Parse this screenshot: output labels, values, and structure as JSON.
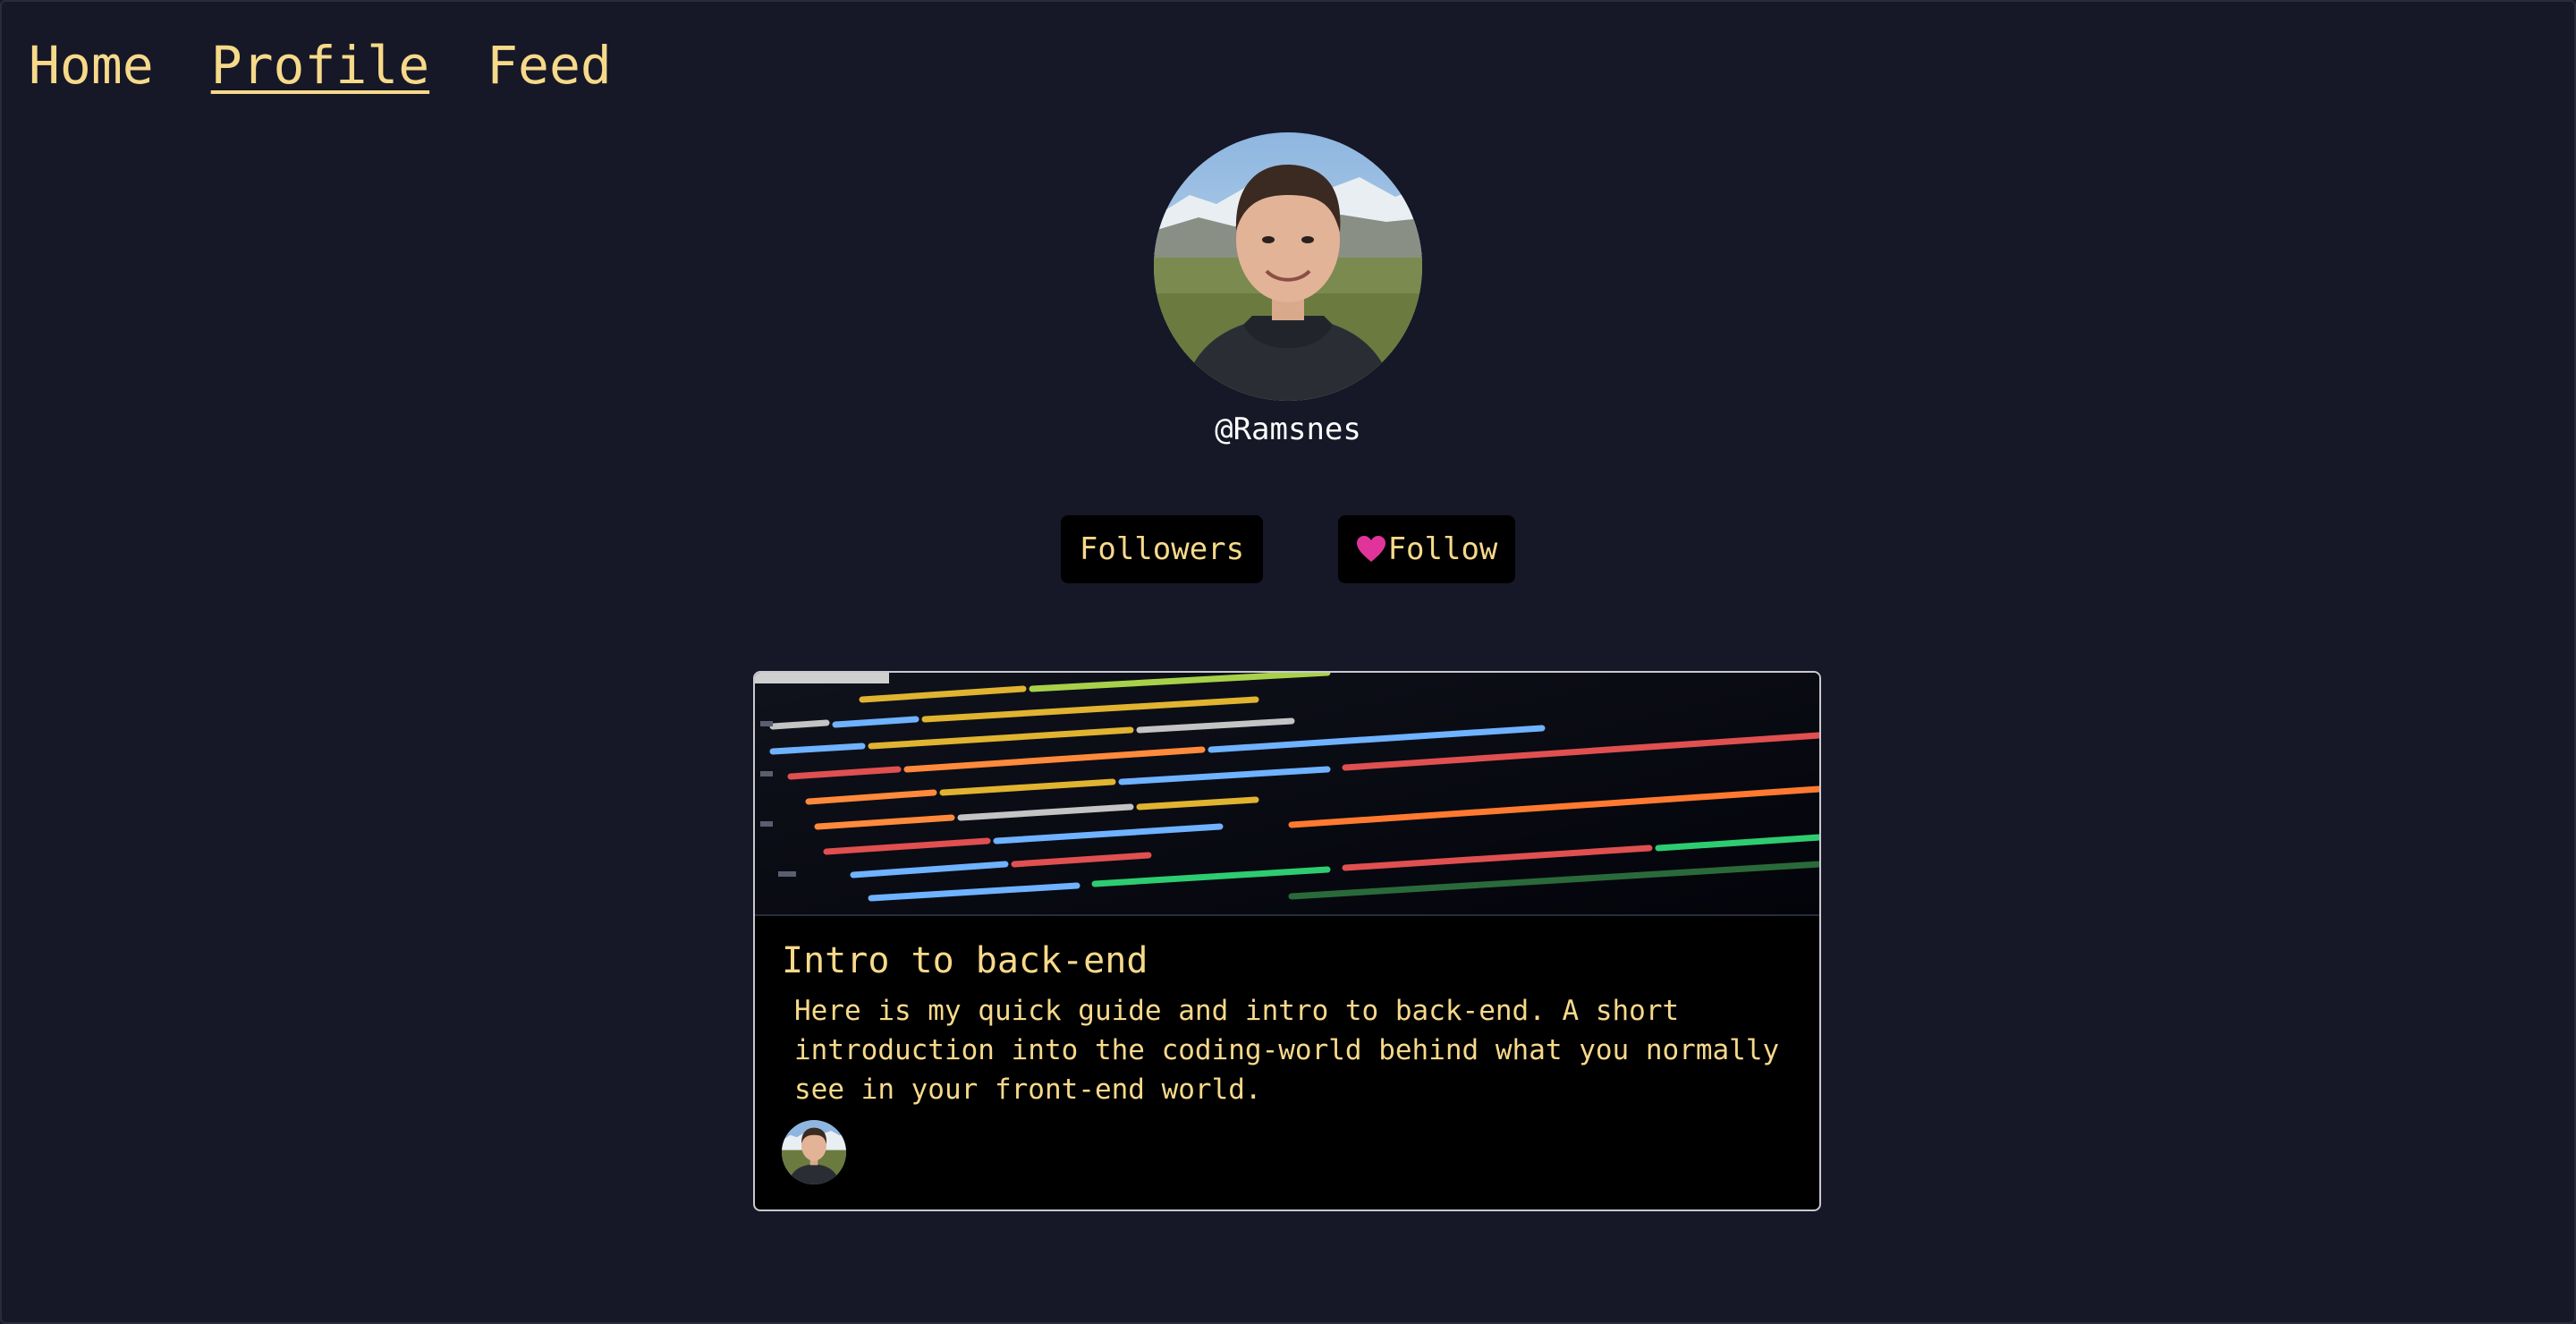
{
  "nav": {
    "items": [
      {
        "label": "Home",
        "active": false
      },
      {
        "label": "Profile",
        "active": true
      },
      {
        "label": "Feed",
        "active": false
      }
    ]
  },
  "profile": {
    "username": "@Ramsnes",
    "followers_label": "Followers",
    "follow_label": "Follow",
    "follow_icon": "heart-icon"
  },
  "post": {
    "title": "Intro to back-end",
    "body": "Here is my quick guide and intro to back-end. A short introduction into the coding-world behind what you normally see in your front-end world."
  },
  "colors": {
    "background": "#161827",
    "accent_text": "#f7d98a",
    "heart": "#e0349a",
    "card": "#000000"
  }
}
